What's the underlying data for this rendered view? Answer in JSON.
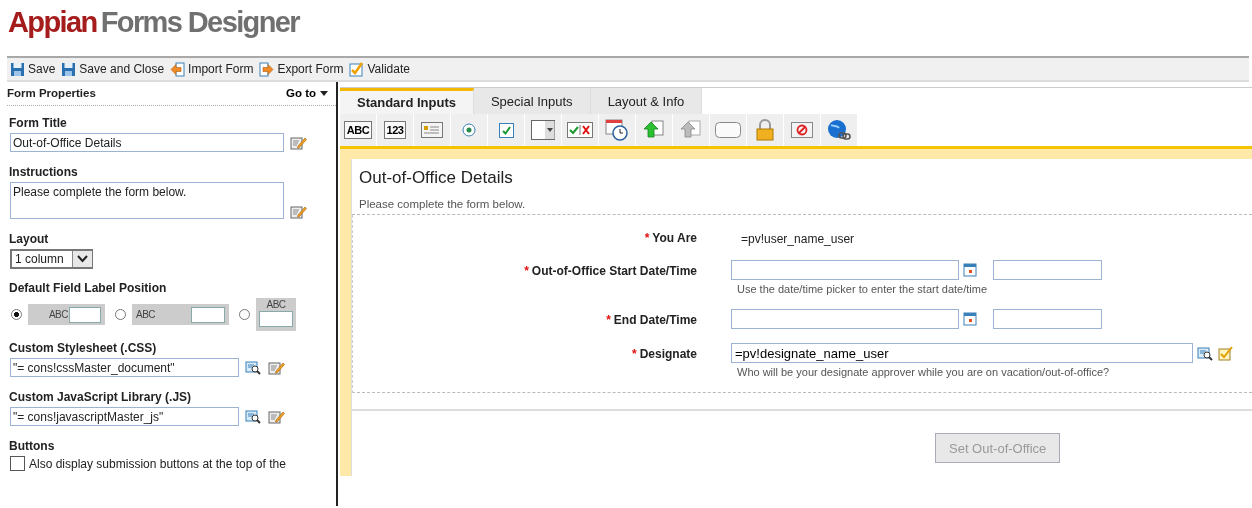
{
  "header": {
    "brand": "Appian",
    "product": "Forms Designer"
  },
  "toolbar": [
    {
      "kind": "save",
      "label": "Save"
    },
    {
      "kind": "save",
      "label": "Save and Close"
    },
    {
      "kind": "import",
      "label": "Import Form"
    },
    {
      "kind": "export",
      "label": "Export Form"
    },
    {
      "kind": "validate",
      "label": "Validate"
    }
  ],
  "properties": {
    "title": "Form Properties",
    "goto": "Go to",
    "form_title": {
      "label": "Form Title",
      "value": "Out-of-Office Details"
    },
    "instructions": {
      "label": "Instructions",
      "value": "Please complete the form below."
    },
    "layout": {
      "label": "Layout",
      "value": "1 column"
    },
    "label_position": {
      "label": "Default Field Label Position",
      "options": [
        {
          "kind": "left-right",
          "sample": "ABC",
          "selected": true
        },
        {
          "kind": "left",
          "sample": "ABC",
          "selected": false
        },
        {
          "kind": "above",
          "sample": "ABC",
          "selected": false
        }
      ]
    },
    "stylesheet": {
      "label": "Custom Stylesheet (.CSS)",
      "value": "\"= cons!cssMaster_document\""
    },
    "javascript": {
      "label": "Custom JavaScript Library (.JS)",
      "value": "\"= cons!javascriptMaster_js\""
    },
    "buttons": {
      "label": "Buttons",
      "option": "Also display submission buttons at the top of the",
      "checked": false
    }
  },
  "tabs": [
    {
      "label": "Standard Inputs",
      "selected": true
    },
    {
      "label": "Special Inputs",
      "selected": false
    },
    {
      "label": "Layout & Info",
      "selected": false
    }
  ],
  "palette": [
    {
      "kind": "text",
      "label": "ABC"
    },
    {
      "kind": "text",
      "label": "123"
    },
    {
      "kind": "paragraph"
    },
    {
      "kind": "radio"
    },
    {
      "kind": "checkbox"
    },
    {
      "kind": "dropdown"
    },
    {
      "kind": "checkx"
    },
    {
      "kind": "datetime"
    },
    {
      "kind": "upload"
    },
    {
      "kind": "upload-grey"
    },
    {
      "kind": "button"
    },
    {
      "kind": "lock"
    },
    {
      "kind": "cancel"
    },
    {
      "kind": "globe"
    }
  ],
  "form": {
    "title": "Out-of-Office Details",
    "instructions": "Please complete the form below.",
    "fields": [
      {
        "kind": "readonly",
        "required_mark": "*",
        "label": "You Are",
        "value": "=pv!user_name_user"
      },
      {
        "kind": "datetime",
        "required_mark": "*",
        "label": "Out-of-Office Start Date/Time",
        "help": "Use the date/time picker to enter the start date/time"
      },
      {
        "kind": "datetime",
        "required_mark": "*",
        "label": "End Date/Time"
      },
      {
        "kind": "picker",
        "required_mark": "*",
        "label": "Designate",
        "value": "=pv!designate_name_user",
        "help": "Who will be your designate approver while you are on vacation/out-of-office?"
      }
    ],
    "button": {
      "label": "Set Out-of-Office",
      "disabled": true
    }
  }
}
